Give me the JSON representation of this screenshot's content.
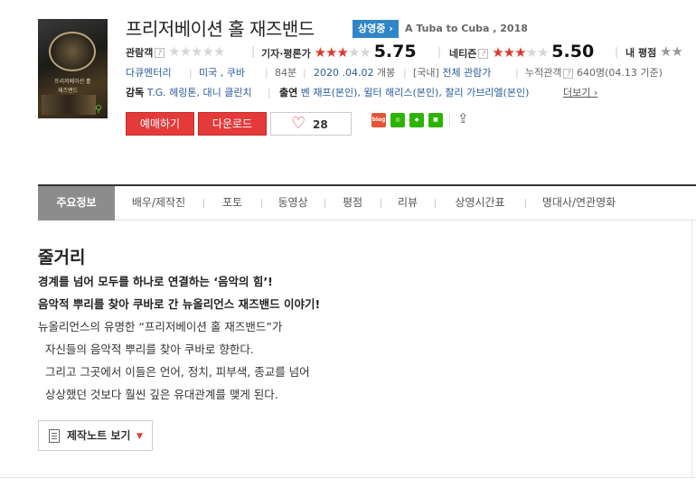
{
  "poster": {
    "text1": "프리저베이션 홀",
    "text2": "재즈밴드"
  },
  "movie": {
    "title": "프리저베이션 홀 재즈밴드",
    "status": "상영중",
    "original_title": "A Tuba to Cuba , 2018"
  },
  "ratings": {
    "audience_label": "관람객",
    "critic_label": "기자·평론가",
    "critic_score": "5.75",
    "netizen_label": "네티즌",
    "netizen_score": "5.50",
    "my_label": "내 평점",
    "help_mark": "?"
  },
  "info": {
    "genre": "다큐멘터리",
    "country": "미국 , 쿠바",
    "runtime": "84분",
    "release_date": "2020 .04.02",
    "release_suffix": "개봉",
    "rating_prefix": "[국내]",
    "rating": "전체 관람가",
    "cum_label": "누적관객",
    "cum_value": "640명",
    "cum_date": "(04.13 기준)"
  },
  "credits": {
    "director_label": "감독",
    "directors": "T.G. 헤링톤, 대니 클린치",
    "cast_label": "출연",
    "cast": "벤 재프(본인), 윌터 해리스(본인), 찰리 가브리엘(본인)",
    "more": "더보기"
  },
  "actions": {
    "reserve": "예매하기",
    "download": "다운로드",
    "like_count": "28"
  },
  "share": [
    "blog-share-icon",
    "talk-share-icon",
    "bookmark-share-icon",
    "me2day-share-icon"
  ],
  "tabs": [
    "주요정보",
    "배우/제작진",
    "포토",
    "동영상",
    "평점",
    "리뷰",
    "상영시간표",
    "명대사/연관영화"
  ],
  "synopsis": {
    "heading": "줄거리",
    "lines": [
      "경계를 넘어 모두를 하나로 연결하는 ‘음악의 힘’!",
      "음악적 뿌리를 찾아 쿠바로 간 뉴올리언스 재즈밴드 이야기!",
      "뉴올리언스의 유명한 “프리저베이션 홀 재즈밴드”가",
      "  자신들의 음악적 뿌리를 찾아 쿠바로 향한다.",
      "  그리고 그곳에서 이들은 언어, 정치, 피부색, 종교를 넘어",
      "  상상했던 것보다 훨씬 깊은 유대관계를 맺게 된다."
    ]
  },
  "note_button": "제작노트 보기",
  "colors": {
    "accent_red": "#e43a3a",
    "status_blue": "#2f86c6",
    "tab_active": "#8c8c8c"
  }
}
